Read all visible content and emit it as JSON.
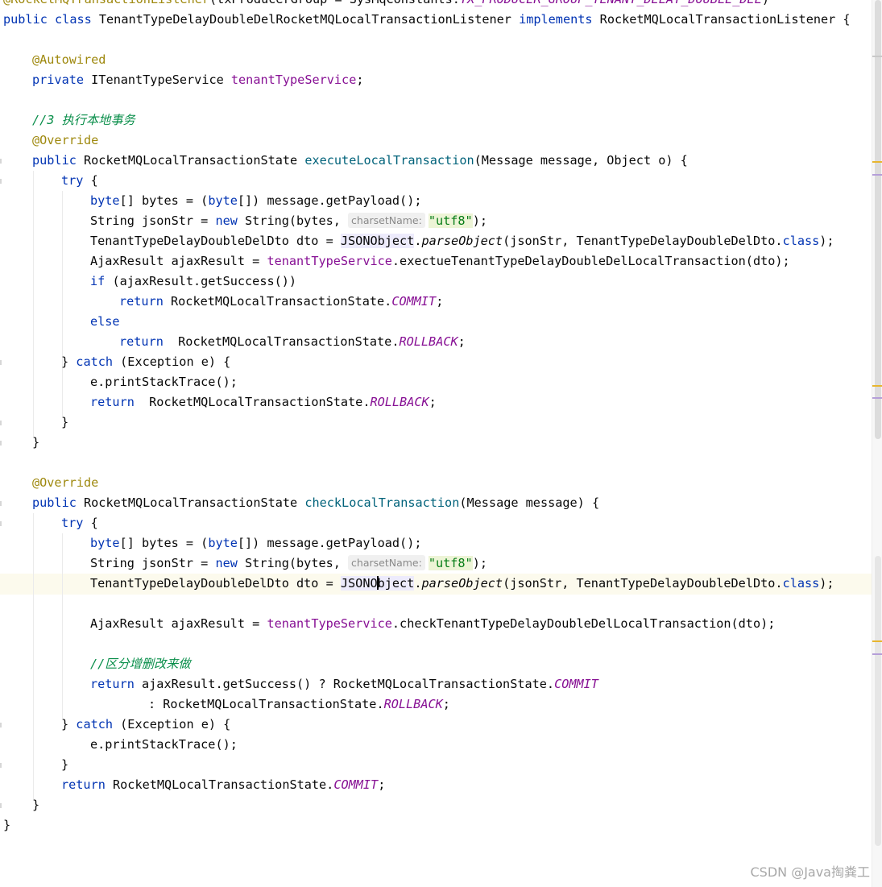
{
  "header": {
    "listener_annotation_partial": "@RocketMQTransactionListener",
    "listener_annotation_args": "(txProducerGroup = SysMqConstants.",
    "listener_annotation_const": "TX_PRODUCER_GROUP_TENANT_DELAY_DOUBLE_DEL",
    "listener_annotation_close": ")",
    "kw_public": "public",
    "kw_class": "class",
    "class_name": " TenantTypeDelayDoubleDelRocketMQLocalTransactionListener ",
    "kw_implements": "implements",
    "interface_name": " RocketMQLocalTransactionListener {"
  },
  "fields": {
    "autowired": "@Autowired",
    "kw_private": "private",
    "type": " ITenantTypeService ",
    "name": "tenantTypeService",
    "end": ";"
  },
  "execute": {
    "comment": "//3 执行本地事务",
    "override": "@Override",
    "kw_public": "public",
    "return_type": " RocketMQLocalTransactionState ",
    "method_name": "executeLocalTransaction",
    "params": "(Message message, Object o) {",
    "kw_try": "try",
    "try_open": " {",
    "l1_kw_byte": "byte",
    "l1_mid": "[] bytes = (",
    "l1_kw_byte2": "byte",
    "l1_end": "[]) message.getPayload();",
    "l2_start": "String jsonStr = ",
    "l2_kw_new": "new",
    "l2_mid": " String(bytes, ",
    "l2_hint": "charsetName:",
    "l2_str": "\"utf8\"",
    "l2_end": ");",
    "l3_start": "TenantTypeDelayDoubleDelDto dto = ",
    "l3_json": "JSONObject",
    "l3_dot": ".",
    "l3_parse": "parseObject",
    "l3_args": "(jsonStr, TenantTypeDelayDoubleDelDto.",
    "l3_kw_class": "class",
    "l3_end": ");",
    "l4_start": "AjaxResult ajaxResult = ",
    "l4_field": "tenantTypeService",
    "l4_end": ".exectueTenantTypeDelayDoubleDelLocalTransaction(dto);",
    "l5_kw_if": "if",
    "l5_end": " (ajaxResult.getSuccess())",
    "l6_kw_return": "return",
    "l6_mid": " RocketMQLocalTransactionState.",
    "l6_const": "COMMIT",
    "l6_end": ";",
    "l7_kw_else": "else",
    "l8_kw_return": "return",
    "l8_mid": "  RocketMQLocalTransactionState.",
    "l8_const": "ROLLBACK",
    "l8_end": ";",
    "catch_open": "} ",
    "kw_catch": "catch",
    "catch_end": " (Exception e) {",
    "c1": "e.printStackTrace();",
    "c2_kw_return": "return",
    "c2_mid": "  RocketMQLocalTransactionState.",
    "c2_const": "ROLLBACK",
    "c2_end": ";",
    "close_inner": "}",
    "close_method": "}"
  },
  "check": {
    "override": "@Override",
    "kw_public": "public",
    "return_type": " RocketMQLocalTransactionState ",
    "method_name": "checkLocalTransaction",
    "params": "(Message message) {",
    "kw_try": "try",
    "try_open": " {",
    "l1_kw_byte": "byte",
    "l1_mid": "[] bytes = (",
    "l1_kw_byte2": "byte",
    "l1_end": "[]) message.getPayload();",
    "l2_start": "String jsonStr = ",
    "l2_kw_new": "new",
    "l2_mid": " String(bytes, ",
    "l2_hint": "charsetName:",
    "l2_str": "\"utf8\"",
    "l2_end": ");",
    "l3_start": "TenantTypeDelayDoubleDelDto dto = ",
    "l3_json_a": "JSONO",
    "l3_json_b": "bject",
    "l3_dot": ".",
    "l3_parse": "parseObject",
    "l3_args": "(jsonStr, TenantTypeDelayDoubleDelDto.",
    "l3_kw_class": "class",
    "l3_end": ");",
    "l4_start": "AjaxResult ajaxResult = ",
    "l4_field": "tenantTypeService",
    "l4_end": ".checkTenantTypeDelayDoubleDelLocalTransaction(dto);",
    "comment": "//区分增删改来做",
    "l5_kw_return": "return",
    "l5_mid": " ajaxResult.getSuccess() ? RocketMQLocalTransactionState.",
    "l5_const": "COMMIT",
    "l6_mid": ": RocketMQLocalTransactionState.",
    "l6_const": "ROLLBACK",
    "l6_end": ";",
    "catch_open": "} ",
    "kw_catch": "catch",
    "catch_end": " (Exception e) {",
    "c1": "e.printStackTrace();",
    "close_inner": "}",
    "r_kw_return": "return",
    "r_mid": " RocketMQLocalTransactionState.",
    "r_const": "COMMIT",
    "r_end": ";",
    "close_method": "}"
  },
  "class_close": "}",
  "watermark": "CSDN @Java掏粪工",
  "colors": {
    "keyword": "#0033b3",
    "annotation": "#9e880d",
    "method": "#00627a",
    "field": "#871094",
    "string": "#067d17",
    "comment": "#8c8c8c",
    "current_line": "#fcfaed"
  }
}
